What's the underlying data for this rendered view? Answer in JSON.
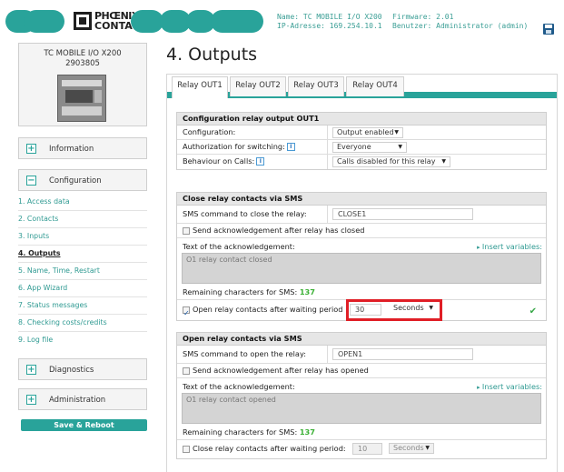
{
  "header": {
    "brand_line1": "PHŒNIX",
    "brand_line2": "CONTACT",
    "name_label": "Name: TC MOBILE I/O X200",
    "ip_label": "IP-Adresse: 169.254.10.1",
    "firmware_label": "Firmware: 2.01",
    "user_label": "Benutzer: Administrator (admin)",
    "save_icon": "save-icon",
    "accent_color": "#29a39a"
  },
  "device": {
    "name": "TC MOBILE I/O X200",
    "article": "2903805"
  },
  "sidebar": {
    "information": {
      "icon": "+",
      "label": "Information"
    },
    "configuration": {
      "icon": "−",
      "label": "Configuration"
    },
    "items": [
      "1. Access data",
      "2. Contacts",
      "3. Inputs",
      "4. Outputs",
      "5. Name, Time, Restart",
      "6. App Wizard",
      "7. Status messages",
      "8. Checking costs/credits",
      "9. Log file"
    ],
    "active_item": "4. Outputs",
    "diagnostics": {
      "icon": "+",
      "label": "Diagnostics"
    },
    "administration": {
      "icon": "+",
      "label": "Administration"
    },
    "reboot_label": "Save & Reboot"
  },
  "main": {
    "title": "4. Outputs",
    "tabs": [
      "Relay OUT1",
      "Relay OUT2",
      "Relay OUT3",
      "Relay OUT4"
    ],
    "active_tab": "Relay OUT1",
    "config_section": {
      "header": "Configuration relay output OUT1",
      "rows": [
        {
          "label": "Configuration:",
          "value": "Output enabled"
        },
        {
          "label": "Authorization for switching:",
          "value": "Everyone",
          "info": "i"
        },
        {
          "label": "Behaviour on Calls:",
          "value": "Calls disabled for this relay",
          "info": "i"
        }
      ]
    },
    "close_section": {
      "header": "Close relay contacts via SMS",
      "cmd_label": "SMS command to close the relay:",
      "cmd_value": "CLOSE1",
      "send_ack_label": "Send acknowledgement after relay has closed",
      "send_ack_checked": false,
      "ack_text_label": "Text of the acknowledgement:",
      "insert_vars": "Insert variables:",
      "ack_text": "O1 relay contact closed",
      "remaining_label": "Remaining characters for SMS:",
      "remaining_value": "137",
      "open_after_label": "Open relay contacts after waiting period",
      "open_after_checked": true,
      "wait_value": "30",
      "wait_unit": "Seconds"
    },
    "open_section": {
      "header": "Open relay contacts via SMS",
      "cmd_label": "SMS command to open the relay:",
      "cmd_value": "OPEN1",
      "send_ack_label": "Send acknowledgement after relay has opened",
      "send_ack_checked": false,
      "ack_text_label": "Text of the acknowledgement:",
      "insert_vars": "Insert variables:",
      "ack_text": "O1 relay contact opened",
      "remaining_label": "Remaining characters for SMS:",
      "remaining_value": "137",
      "close_after_label": "Close relay contacts after waiting period:",
      "close_after_checked": false,
      "wait_value": "10",
      "wait_unit": "Seconds"
    }
  }
}
